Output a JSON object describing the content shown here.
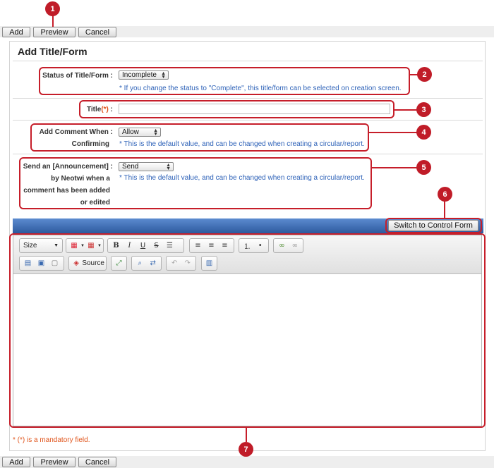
{
  "actions": {
    "add": "Add",
    "preview": "Preview",
    "cancel": "Cancel"
  },
  "page_title": "Add Title/Form",
  "status": {
    "label": "Status of Title/Form :",
    "value": "Incomplete",
    "note": "* If you change the status to \"Complete\", this title/form can be selected on creation screen."
  },
  "title_field": {
    "label": "Title",
    "required_mark": "(*)",
    "colon": " :",
    "value": ""
  },
  "add_comment": {
    "label_line1": "Add Comment When :",
    "label_line2": "Confirming",
    "value": "Allow",
    "note": "* This is the default value, and can be changed when creating a circular/report."
  },
  "announcement": {
    "label_line1": "Send an [Announcement] :",
    "label_line2": "by Neotwi when a",
    "label_line3": "comment has been added",
    "label_line4": "or edited",
    "value": "Send",
    "note": "* This is the default value, and can be changed when creating a circular/report."
  },
  "switch_button": "Switch to Control Form",
  "editor": {
    "size_label": "Size",
    "source_label": "Source",
    "icons": [
      "bold",
      "italic",
      "underline",
      "strikethrough",
      "horizontal-rule",
      "align-left",
      "align-center",
      "align-right",
      "numbered-list",
      "bulleted-list",
      "link",
      "unlink",
      "new-page",
      "paste-from-word",
      "preview",
      "source",
      "maximize",
      "find",
      "replace",
      "undo",
      "redo",
      "show-blocks",
      "text-color",
      "table"
    ]
  },
  "mandatory_note": "* (*) is a mandatory field.",
  "callouts": [
    "1",
    "2",
    "3",
    "4",
    "5",
    "6",
    "7"
  ],
  "colors": {
    "highlight": "#c61e2a",
    "callout": "#c01c28",
    "note": "#2e62b8",
    "mandatory": "#e0531a"
  }
}
